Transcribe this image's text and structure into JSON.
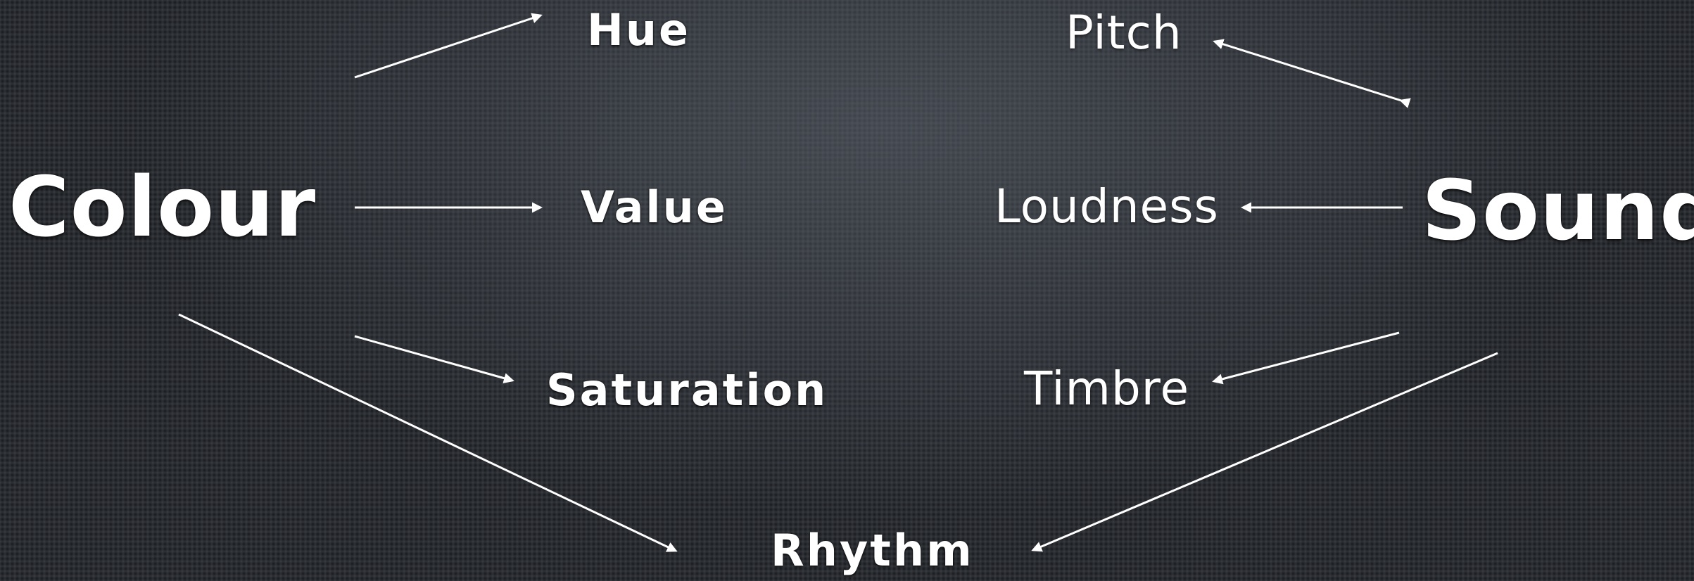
{
  "diagram": {
    "colour": {
      "label": "Colour",
      "properties": {
        "hue": "Hue",
        "value": "Value",
        "saturation": "Saturation"
      }
    },
    "sound": {
      "label": "Sound",
      "properties": {
        "pitch": "Pitch",
        "loudness": "Loudness",
        "timbre": "Timbre"
      }
    },
    "shared": {
      "rhythm": "Rhythm"
    }
  },
  "colors": {
    "background": "#2b2e33",
    "text": "#ffffff",
    "arrow": "#ffffff"
  }
}
